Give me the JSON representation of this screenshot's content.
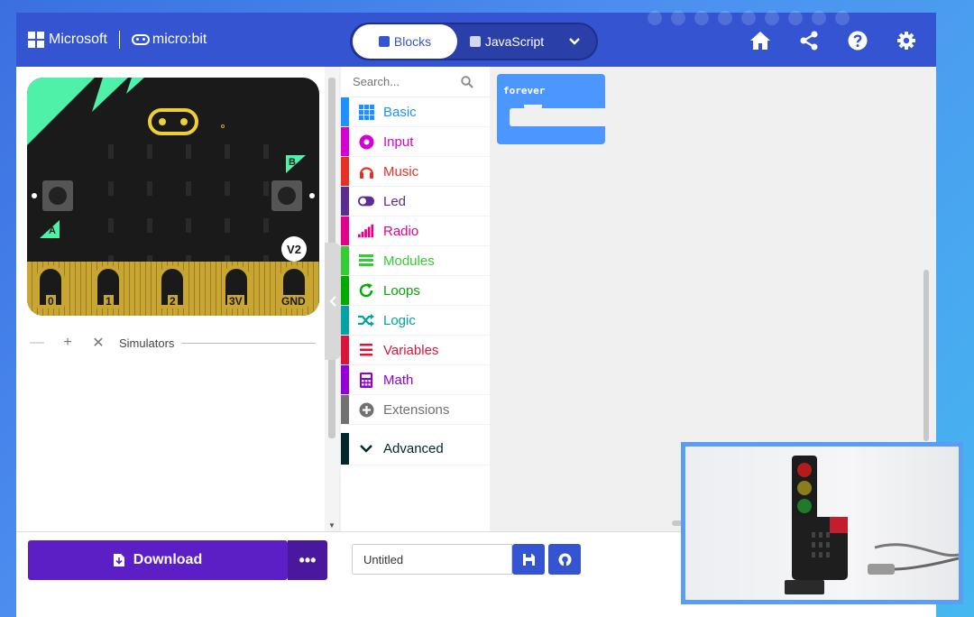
{
  "header": {
    "brand_microsoft": "Microsoft",
    "brand_microbit": "micro:bit",
    "tabs": [
      {
        "label": "Blocks",
        "active": true
      },
      {
        "label": "JavaScript",
        "active": false
      }
    ],
    "icons": [
      "home-icon",
      "share-icon",
      "help-icon",
      "settings-icon"
    ],
    "color": "#3454d1"
  },
  "simulator": {
    "title": "Simulators",
    "pins": [
      "0",
      "1",
      "2",
      "3V",
      "GND"
    ],
    "button_a": "A",
    "button_b": "B",
    "version_badge": "V2",
    "controls": [
      "minus-icon",
      "plus-icon",
      "close-icon"
    ]
  },
  "toolbox": {
    "search_placeholder": "Search...",
    "categories": [
      {
        "label": "Basic",
        "color": "#1e90ff",
        "icon": "grid-icon"
      },
      {
        "label": "Input",
        "color": "#d400d4",
        "icon": "target-icon"
      },
      {
        "label": "Music",
        "color": "#e63022",
        "icon": "headphones-icon"
      },
      {
        "label": "Led",
        "color": "#5c2d91",
        "icon": "toggle-icon"
      },
      {
        "label": "Radio",
        "color": "#e3008c",
        "icon": "signal-bars-icon"
      },
      {
        "label": "Modules",
        "color": "#33cc33",
        "icon": "layers-icon"
      },
      {
        "label": "Loops",
        "color": "#00aa00",
        "icon": "refresh-icon"
      },
      {
        "label": "Logic",
        "color": "#00a4a6",
        "icon": "shuffle-icon"
      },
      {
        "label": "Variables",
        "color": "#dc143c",
        "icon": "list-icon"
      },
      {
        "label": "Math",
        "color": "#9400d3",
        "icon": "calculator-icon"
      },
      {
        "label": "Extensions",
        "color": "#717171",
        "icon": "plus-circle-icon"
      },
      {
        "label": "Advanced",
        "color": "#00272b",
        "icon": "chevron-down-icon"
      }
    ]
  },
  "workspace": {
    "block_label": "forever",
    "block_color": "#4c97ff"
  },
  "footer": {
    "download_label": "Download",
    "more_label": "•••",
    "project_name": "Untitled"
  }
}
